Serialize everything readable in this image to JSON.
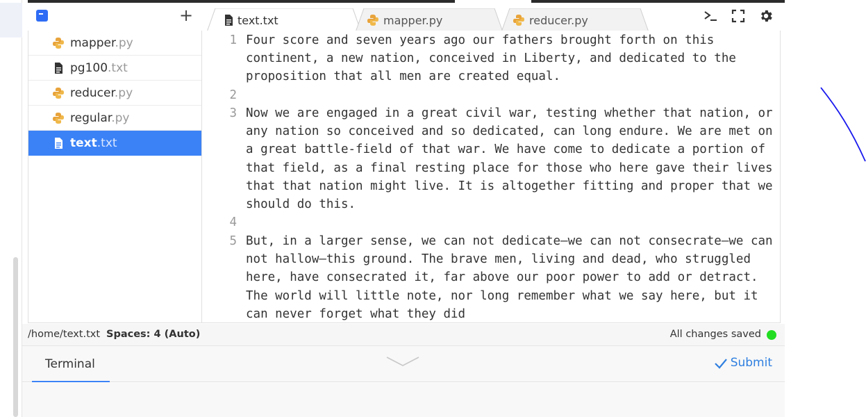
{
  "sidebar": {
    "files": [
      {
        "name": "mapper",
        "ext": ".py",
        "icon": "python-icon",
        "active": false
      },
      {
        "name": "pg100",
        "ext": ".txt",
        "icon": "document-icon",
        "active": false
      },
      {
        "name": "reducer",
        "ext": ".py",
        "icon": "python-icon",
        "active": false
      },
      {
        "name": "regular",
        "ext": ".py",
        "icon": "python-icon",
        "active": false
      },
      {
        "name": "text",
        "ext": ".txt",
        "icon": "document-icon",
        "active": true
      }
    ]
  },
  "tabs": [
    {
      "label": "text.txt",
      "icon": "document-icon",
      "active": true
    },
    {
      "label": "mapper.py",
      "icon": "python-icon",
      "active": false
    },
    {
      "label": "reducer.py",
      "icon": "python-icon",
      "active": false
    }
  ],
  "toolbar_icons": [
    "terminal-icon",
    "fullscreen-icon",
    "gear-icon"
  ],
  "editor": {
    "lines": [
      {
        "number": "1",
        "text": "Four score and seven years ago our fathers brought forth on this continent, a new nation, conceived in Liberty, and dedicated to the proposition that all men are created equal."
      },
      {
        "number": "2",
        "text": ""
      },
      {
        "number": "3",
        "text": "Now we are engaged in a great civil war, testing whether that nation, or any nation so conceived and so dedicated, can long endure. We are met on a great battle-field of that war. We have come to dedicate a portion of that field, as a final resting place for those who here gave their lives that that nation might live. It is altogether fitting and proper that we should do this."
      },
      {
        "number": "4",
        "text": ""
      },
      {
        "number": "5",
        "text": "But, in a larger sense, we can not dedicate—we can not consecrate—we can not hallow—this ground. The brave men, living and dead, who struggled here, have consecrated it, far above our poor power to add or detract. The world will little note, nor long remember what we say here, but it can never forget what they did"
      }
    ]
  },
  "status": {
    "path": "/home/text.txt",
    "spaces": "Spaces: 4 (Auto)",
    "saved": "All changes saved"
  },
  "terminal": {
    "tab_label": "Terminal",
    "submit_label": "Submit"
  },
  "colors": {
    "accent": "#3b82f6",
    "saved_dot": "#22dd22",
    "submit": "#2f7fe0"
  }
}
